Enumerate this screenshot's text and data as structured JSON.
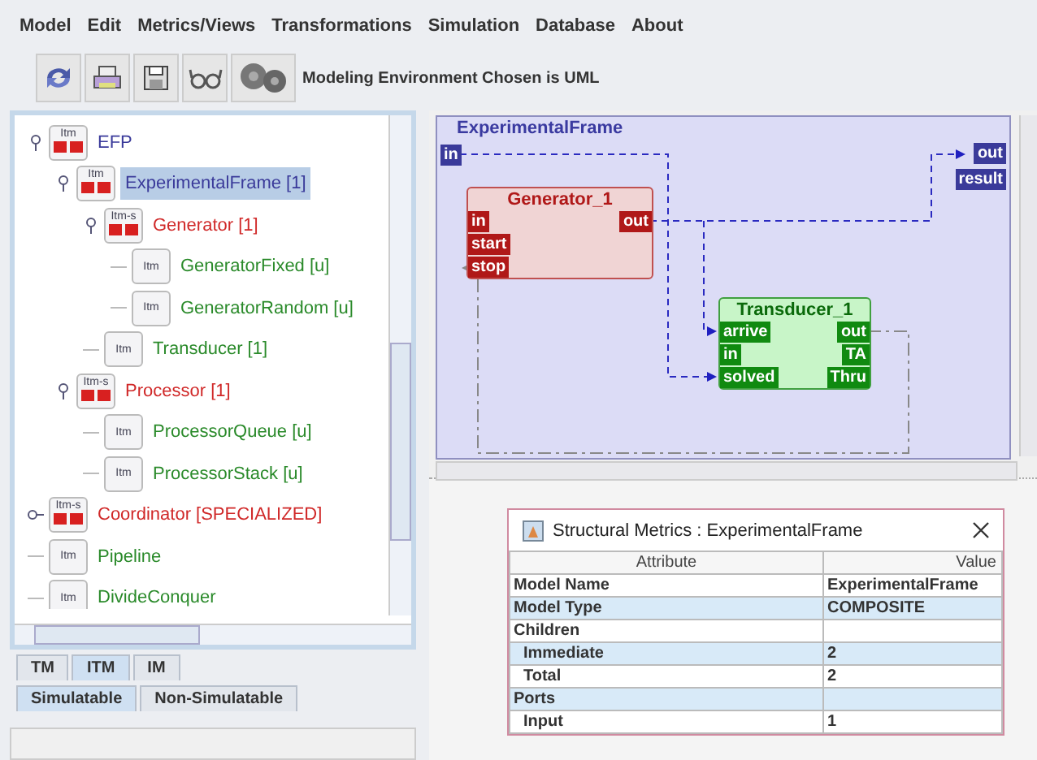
{
  "menu": [
    "Model",
    "Edit",
    "Metrics/Views",
    "Transformations",
    "Simulation",
    "Database",
    "About"
  ],
  "toolbar": {
    "buttons": [
      {
        "kind": "sync"
      },
      {
        "kind": "print"
      },
      {
        "kind": "save"
      },
      {
        "kind": "glasses"
      },
      {
        "kind": "gears"
      }
    ],
    "status": "Modeling Environment Chosen is UML"
  },
  "tree": [
    {
      "label": "EFP",
      "kind": "coupled",
      "icon_label": "Itm",
      "expanded": true,
      "selected": false,
      "children": [
        {
          "label": "ExperimentalFrame [1]",
          "kind": "coupled",
          "icon_label": "Itm",
          "expanded": true,
          "selected": true,
          "children": [
            {
              "label": "Generator [1]",
              "kind": "specialized",
              "icon_label": "Itm-s",
              "expanded": true,
              "selected": false,
              "children": [
                {
                  "label": "GeneratorFixed [u]",
                  "kind": "atomic",
                  "icon_label": "Itm",
                  "selected": false
                },
                {
                  "label": "GeneratorRandom [u]",
                  "kind": "atomic",
                  "icon_label": "Itm",
                  "selected": false
                }
              ]
            },
            {
              "label": "Transducer [1]",
              "kind": "atomic",
              "icon_label": "Itm",
              "selected": false
            }
          ]
        },
        {
          "label": "Processor [1]",
          "kind": "specialized",
          "icon_label": "Itm-s",
          "expanded": true,
          "selected": false,
          "children": [
            {
              "label": "ProcessorQueue [u]",
              "kind": "atomic",
              "icon_label": "Itm",
              "selected": false
            },
            {
              "label": "ProcessorStack [u]",
              "kind": "atomic",
              "icon_label": "Itm",
              "selected": false
            }
          ]
        }
      ]
    },
    {
      "label": "Coordinator [SPECIALIZED]",
      "kind": "specialized",
      "icon_label": "Itm-s",
      "expanded": false,
      "selected": false
    },
    {
      "label": "Pipeline",
      "kind": "atomic",
      "icon_label": "Itm",
      "selected": false
    },
    {
      "label": "DivideConquer",
      "kind": "atomic",
      "icon_label": "Itm",
      "selected": false
    }
  ],
  "model_tabs": [
    {
      "label": "TM",
      "selected": false
    },
    {
      "label": "ITM",
      "selected": true
    },
    {
      "label": "IM",
      "selected": false
    }
  ],
  "category_tabs": [
    {
      "label": "Simulatable",
      "selected": true
    },
    {
      "label": "Non-Simulatable",
      "selected": false
    }
  ],
  "diagram": {
    "title": "ExperimentalFrame",
    "in_ports": [
      "in"
    ],
    "out_ports": [
      "out",
      "result"
    ],
    "blocks": [
      {
        "name": "Generator_1",
        "kind": "generator",
        "inputs": [
          "in",
          "start",
          "stop"
        ],
        "outputs": [
          "out"
        ]
      },
      {
        "name": "Transducer_1",
        "kind": "transducer",
        "inputs": [
          "arrive",
          "in",
          "solved"
        ],
        "outputs": [
          "out",
          "TA",
          "Thru"
        ]
      }
    ]
  },
  "metrics_dialog": {
    "title": "Structural Metrics : ExperimentalFrame",
    "columns": [
      "Attribute",
      "Value"
    ],
    "rows": [
      {
        "attribute": "Model Name",
        "value": "ExperimentalFrame",
        "kind": "group"
      },
      {
        "attribute": "Model Type",
        "value": "COMPOSITE",
        "kind": "group"
      },
      {
        "attribute": "Children",
        "kind": "group"
      },
      {
        "attribute": "Immediate",
        "value": "2",
        "kind": "child"
      },
      {
        "attribute": "Total",
        "value": "2",
        "kind": "child"
      },
      {
        "attribute": "Ports",
        "kind": "group"
      },
      {
        "attribute": "Input",
        "value": "1",
        "kind": "child"
      }
    ]
  }
}
